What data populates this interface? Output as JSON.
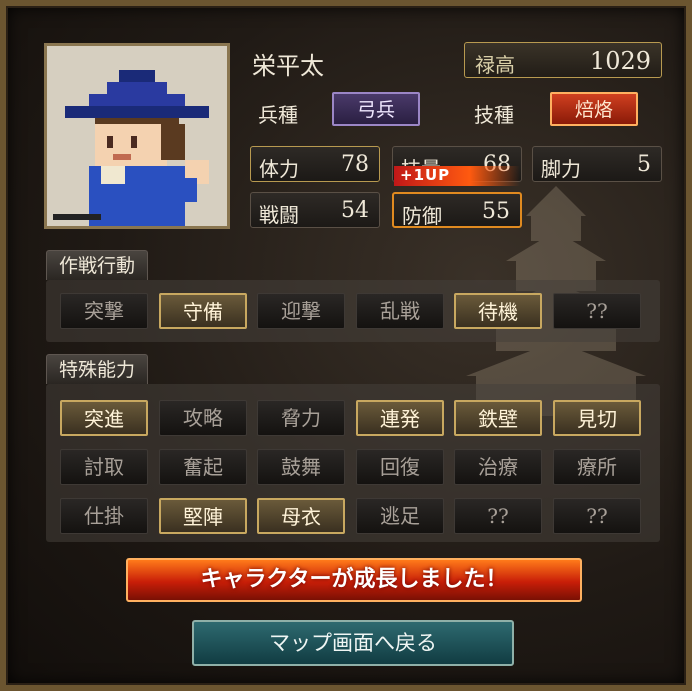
{
  "character": {
    "name": "栄平太",
    "rokudaka_label": "禄高",
    "rokudaka_value": "1029",
    "unit_type_label": "兵種",
    "unit_type_value": "弓兵",
    "skill_type_label": "技種",
    "skill_type_value": "焙烙"
  },
  "stats": {
    "hp": {
      "label": "体力",
      "value": "78"
    },
    "skill": {
      "label": "技量",
      "value": "68"
    },
    "speed": {
      "label": "脚力",
      "value": "5"
    },
    "combat": {
      "label": "戦闘",
      "value": "54"
    },
    "defense": {
      "label": "防御",
      "value": "55"
    },
    "levelup_badge": "+1UP"
  },
  "tactics": {
    "title": "作戦行動",
    "items": [
      {
        "label": "突撃",
        "active": false
      },
      {
        "label": "守備",
        "active": true
      },
      {
        "label": "迎撃",
        "active": false
      },
      {
        "label": "乱戦",
        "active": false
      },
      {
        "label": "待機",
        "active": true
      },
      {
        "label": "??",
        "active": false
      }
    ]
  },
  "abilities": {
    "title": "特殊能力",
    "rows": [
      [
        {
          "label": "突進",
          "active": true
        },
        {
          "label": "攻略",
          "active": false
        },
        {
          "label": "脅力",
          "active": false
        },
        {
          "label": "連発",
          "active": true
        },
        {
          "label": "鉄壁",
          "active": true
        },
        {
          "label": "見切",
          "active": true
        }
      ],
      [
        {
          "label": "討取",
          "active": false
        },
        {
          "label": "奮起",
          "active": false
        },
        {
          "label": "鼓舞",
          "active": false
        },
        {
          "label": "回復",
          "active": false
        },
        {
          "label": "治療",
          "active": false
        },
        {
          "label": "療所",
          "active": false
        }
      ],
      [
        {
          "label": "仕掛",
          "active": false
        },
        {
          "label": "堅陣",
          "active": true
        },
        {
          "label": "母衣",
          "active": true
        },
        {
          "label": "逃足",
          "active": false
        },
        {
          "label": "??",
          "active": false
        },
        {
          "label": "??",
          "active": false
        }
      ]
    ]
  },
  "banner": {
    "text": "キャラクターが成長しました！"
  },
  "back_button": {
    "label": "マップ画面へ戻る"
  },
  "icons": {
    "portrait": "ashigaru-archer-portrait",
    "background": "castle-silhouette"
  }
}
